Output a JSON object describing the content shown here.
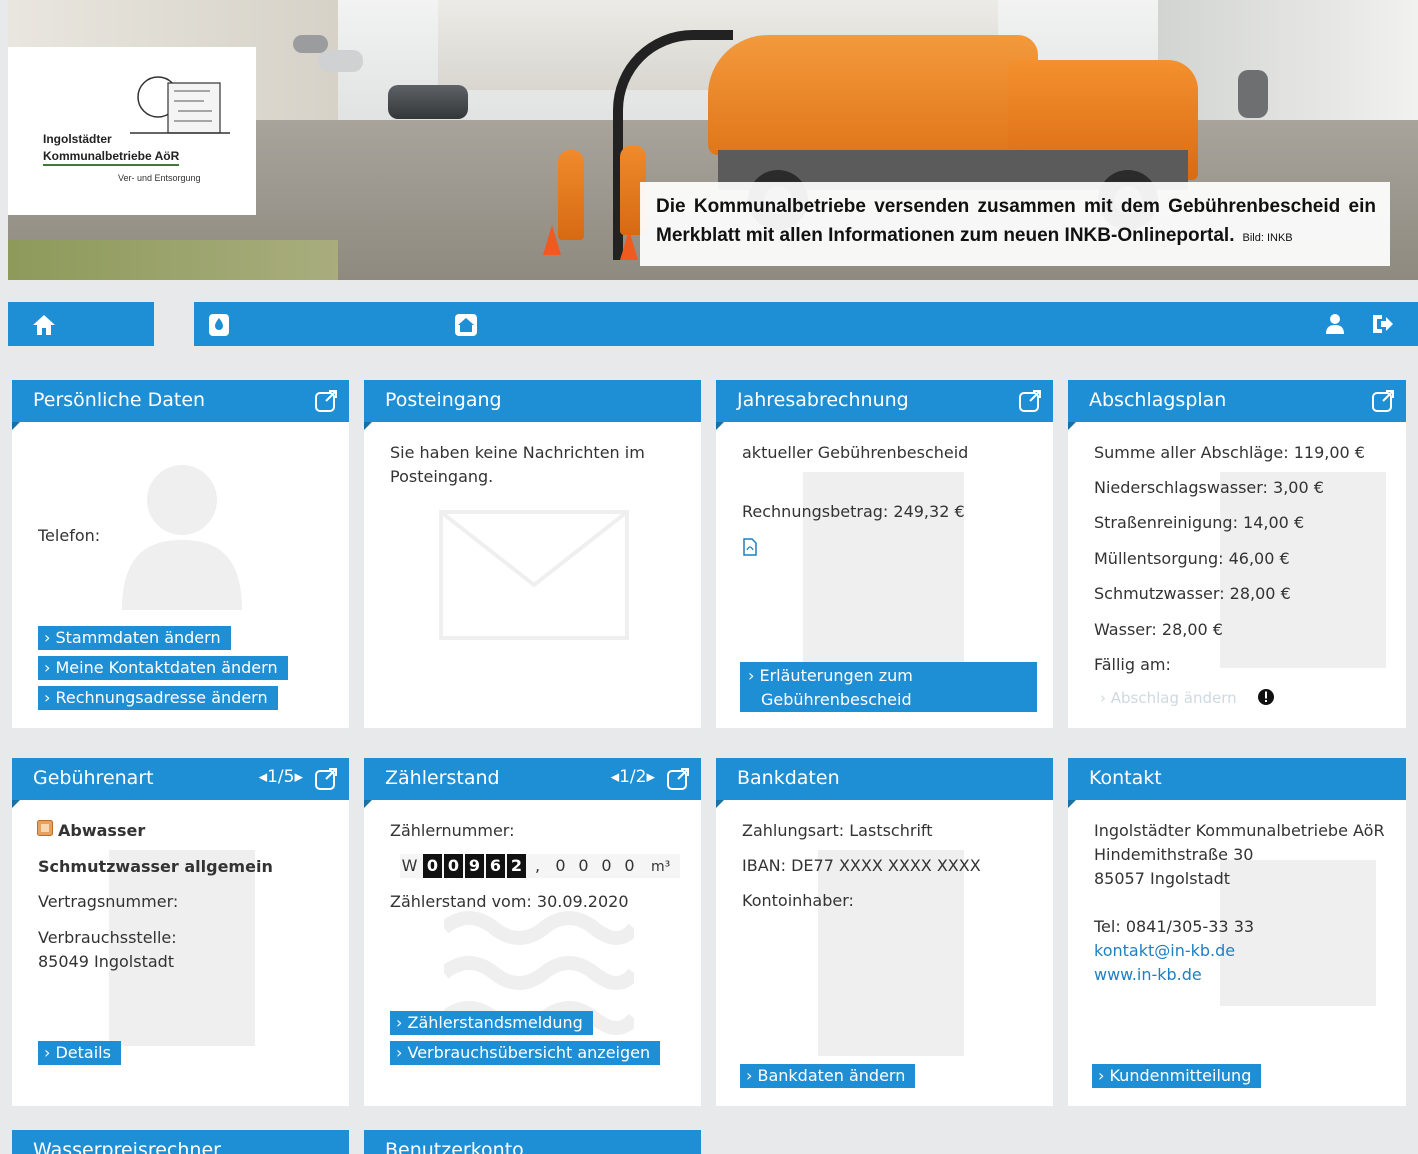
{
  "logo": {
    "line1": "Ingolstädter",
    "line2": "Kommunalbetriebe AöR",
    "line3": "Ver- und Entsorgung"
  },
  "caption": {
    "text": "Die Kommunalbetriebe versenden zusammen mit dem Gebührenbescheid ein Merkblatt mit allen Informationen zum neuen INKB-Onlineportal.",
    "credit": "Bild: INKB"
  },
  "nav": {
    "icons": [
      "home-icon",
      "water-meter-icon",
      "house-icon",
      "user-icon",
      "logout-icon"
    ]
  },
  "tiles": {
    "personal": {
      "title": "Persönliche Daten",
      "phone_label": "Telefon:",
      "buttons": [
        "› Stammdaten ändern",
        "› Meine Kontaktdaten ändern",
        "› Rechnungsadresse ändern"
      ]
    },
    "inbox": {
      "title": "Posteingang",
      "message": "Sie haben keine Nachrichten im Posteingang."
    },
    "annual": {
      "title": "Jahresabrechnung",
      "line1": "aktueller Gebührenbescheid",
      "line2": "Rechnungsbetrag: 249,32 €",
      "button_l1": "› Erläuterungen zum",
      "button_l2": "Gebührenbescheid"
    },
    "installment": {
      "title": "Abschlagsplan",
      "lines": [
        "Summe aller Abschläge: 119,00 €",
        "Niederschlagswasser: 3,00 €",
        "Straßenreinigung: 14,00 €",
        "Müllentsorgung: 46,00 €",
        "Schmutzwasser: 28,00 €",
        "Wasser: 28,00 €",
        "Fällig am:"
      ],
      "button": "› Abschlag ändern"
    },
    "fee_type": {
      "title": "Gebührenart",
      "pager": "◂1/5▸",
      "category": "Abwasser",
      "subcategory": "Schmutzwasser allgemein",
      "contract_label": "Vertragsnummer:",
      "location_label": "Verbrauchsstelle:",
      "location_value": "85049 Ingolstadt",
      "button": "› Details"
    },
    "meter": {
      "title": "Zählerstand",
      "pager": "◂1/2▸",
      "number_label": "Zählernummer:",
      "prefix": "W",
      "digits": [
        "0",
        "0",
        "9",
        "6",
        "2"
      ],
      "separator": ",",
      "decimals": [
        "0",
        "0",
        "0",
        "0"
      ],
      "unit": "m³",
      "date_line": "Zählerstand vom: 30.09.2020",
      "buttons": [
        "› Zählerstandsmeldung",
        "› Verbrauchsübersicht anzeigen"
      ]
    },
    "bank": {
      "title": "Bankdaten",
      "payment": "Zahlungsart: Lastschrift",
      "iban": "IBAN: DE77 XXXX XXXX XXXX",
      "holder": "Kontoinhaber:",
      "button": "› Bankdaten ändern"
    },
    "contact": {
      "title": "Kontakt",
      "addr1": "Ingolstädter Kommunalbetriebe AöR",
      "addr2": "Hindemithstraße 30",
      "addr3": "85057 Ingolstadt",
      "tel": "Tel: 0841/305-33 33",
      "email": "kontakt@in-kb.de",
      "web": "www.in-kb.de",
      "button": "› Kundenmitteilung"
    },
    "water_calc": {
      "title": "Wasserpreisrechner"
    },
    "account": {
      "title": "Benutzerkonto"
    }
  },
  "colors": {
    "accent": "#1e8fd5",
    "accent_dark": "#1a6fa5",
    "background": "#e8e9eb"
  }
}
